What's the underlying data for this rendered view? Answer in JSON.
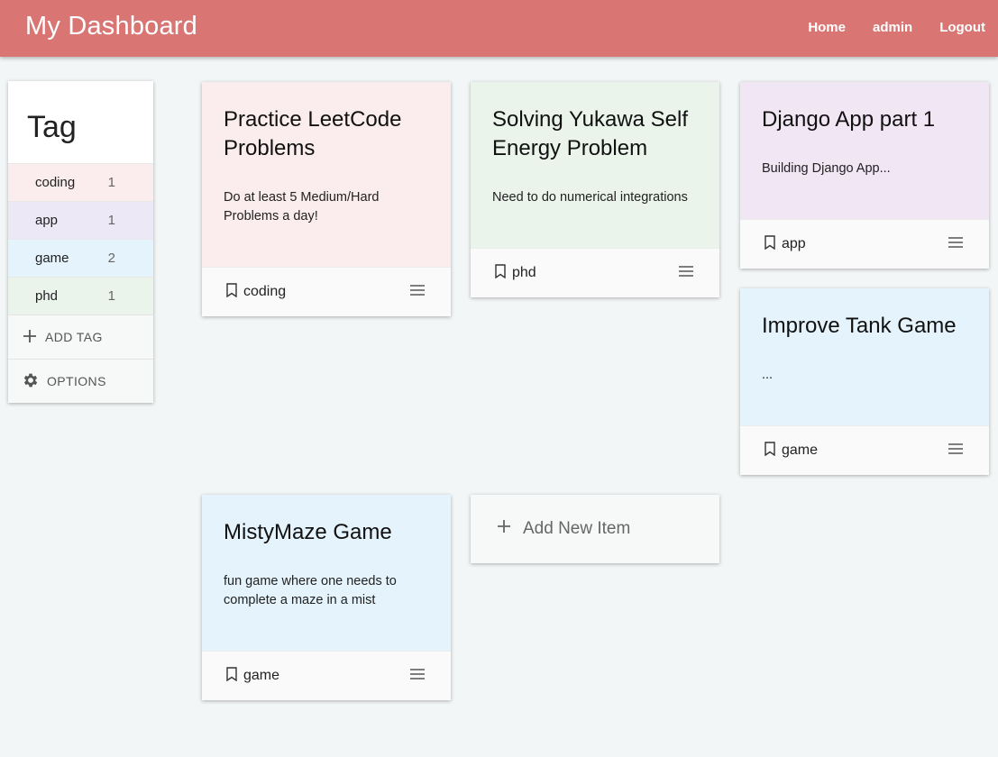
{
  "header": {
    "brand": "My Dashboard",
    "nav": [
      "Home",
      "admin",
      "Logout"
    ],
    "color": "#d97573"
  },
  "sidebar": {
    "title": "Tag",
    "tags": [
      {
        "name": "coding",
        "count": "1",
        "color": "#fbeced"
      },
      {
        "name": "app",
        "count": "1",
        "color": "#ece8f5"
      },
      {
        "name": "game",
        "count": "2",
        "color": "#e5f3fc"
      },
      {
        "name": "phd",
        "count": "1",
        "color": "#eaf4eb"
      }
    ],
    "add_tag": "ADD TAG",
    "options": "OPTIONS"
  },
  "cards": [
    {
      "title": "Practice LeetCode Problems",
      "description": "Do at least 5 Medium/Hard Problems a day!",
      "tag": "coding",
      "color": "#fbeced"
    },
    {
      "title": "Solving Yukawa Self Energy Problem",
      "description": "Need to do numerical integrations",
      "tag": "phd",
      "color": "#eaf4eb"
    },
    {
      "title": "Django App part 1",
      "description": "Building Django App...",
      "tag": "app",
      "color": "#f1e6f4"
    },
    {
      "title": "Improve Tank Game",
      "description": "...",
      "tag": "game",
      "color": "#e5f3fc"
    },
    {
      "title": "MistyMaze Game",
      "description": "fun game where one needs to complete a maze in a mist",
      "tag": "game",
      "color": "#e5f3fc"
    }
  ],
  "add_item": "Add New Item",
  "icons": [
    "plus-icon",
    "gear-icon",
    "bookmark-icon",
    "menu-icon"
  ]
}
